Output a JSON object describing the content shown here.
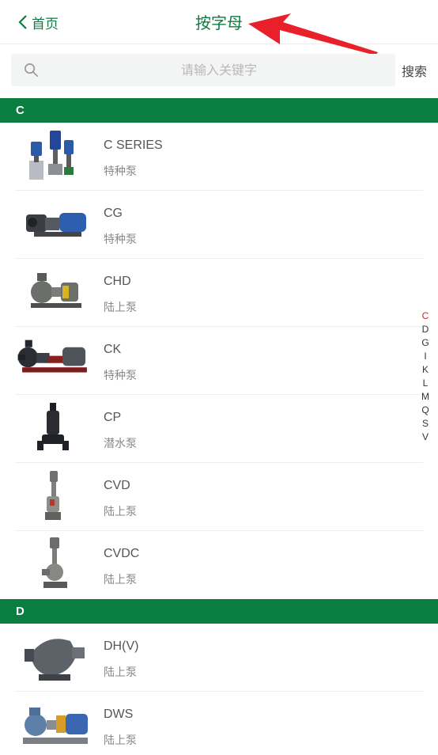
{
  "header": {
    "back_label": "首页",
    "title": "按字母"
  },
  "search": {
    "placeholder": "请输入关键字",
    "button_label": "搜索"
  },
  "sections": [
    {
      "letter": "C",
      "items": [
        {
          "name": "C SERIES",
          "category": "特种泵"
        },
        {
          "name": "CG",
          "category": "特种泵"
        },
        {
          "name": "CHD",
          "category": "陆上泵"
        },
        {
          "name": "CK",
          "category": "特种泵"
        },
        {
          "name": "CP",
          "category": "潜水泵"
        },
        {
          "name": "CVD",
          "category": "陆上泵"
        },
        {
          "name": "CVDC",
          "category": "陆上泵"
        }
      ]
    },
    {
      "letter": "D",
      "items": [
        {
          "name": "DH(V)",
          "category": "陆上泵"
        },
        {
          "name": "DWS",
          "category": "陆上泵"
        }
      ]
    }
  ],
  "alpha_index": [
    "C",
    "D",
    "G",
    "I",
    "K",
    "L",
    "M",
    "Q",
    "S",
    "V"
  ],
  "alpha_index_active": "C",
  "colors": {
    "brand_green": "#0a7d41",
    "active_letter": "#e02020",
    "annotation_arrow": "#e8202a"
  }
}
